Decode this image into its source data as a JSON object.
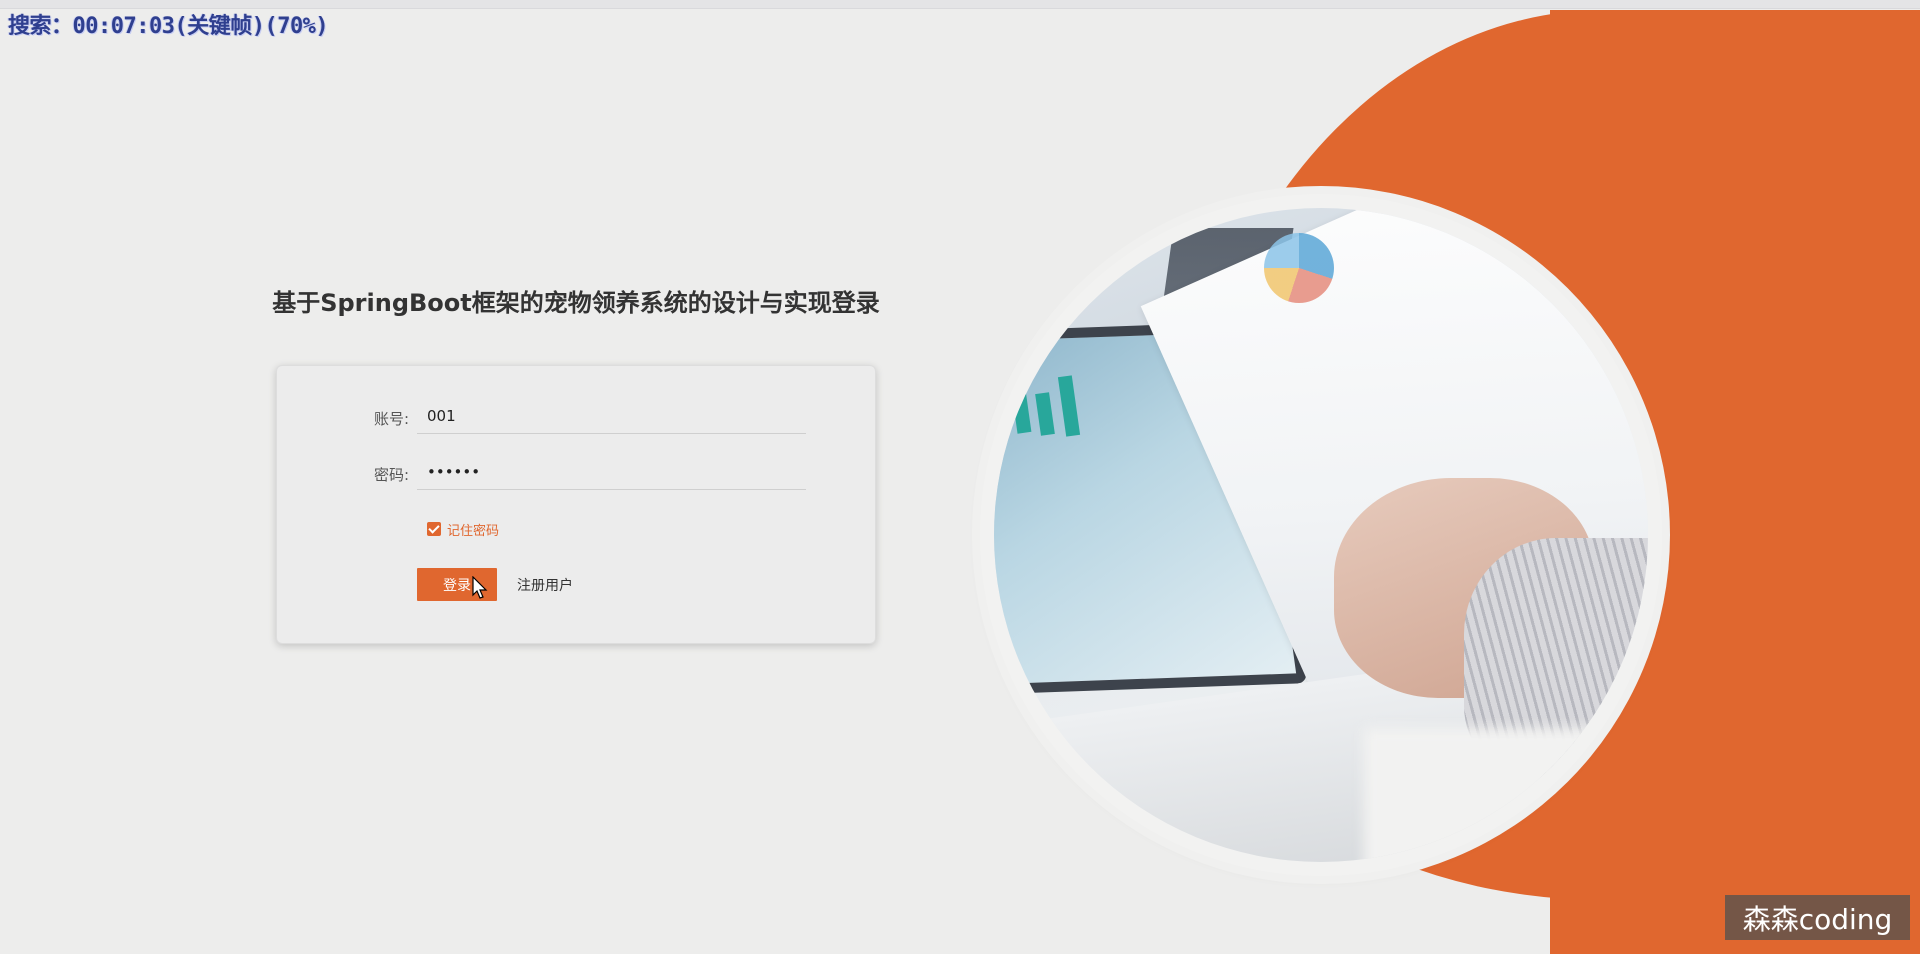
{
  "overlay": {
    "search_text": "搜索：00:07:03(关键帧)(70%)"
  },
  "page": {
    "title": "基于SpringBoot框架的宠物领养系统的设计与实现登录"
  },
  "form": {
    "account_label": "账号:",
    "account_value": "001",
    "password_label": "密码:",
    "password_value": "••••••",
    "remember_label": "记住密码",
    "remember_checked": true,
    "login_button": "登录",
    "register_link": "注册用户"
  },
  "watermark": {
    "text": "森森coding"
  },
  "colors": {
    "accent": "#e0672f",
    "background": "#ededec"
  }
}
